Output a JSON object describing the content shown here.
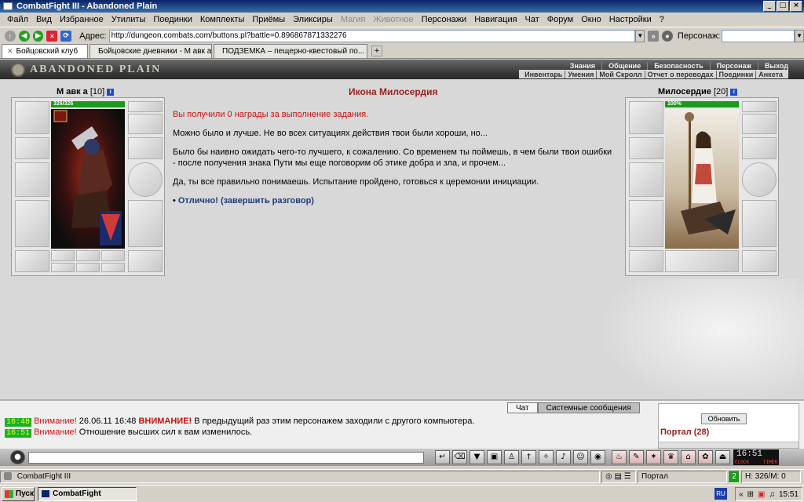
{
  "window": {
    "title": "CombatFight III - Abandoned Plain"
  },
  "menu": [
    "Файл",
    "Вид",
    "Избранное",
    "Утилиты",
    "Поединки",
    "Комплекты",
    "Приёмы",
    "Эликсиры",
    "Магия",
    "Животное",
    "Персонажи",
    "Навигация",
    "Чат",
    "Форум",
    "Окно",
    "Настройки",
    "?"
  ],
  "address": {
    "label": "Адрес:",
    "url": "http://dungeon.combats.com/buttons.pl?battle=0.896867871332276",
    "persona_label": "Персонаж:"
  },
  "tabs": [
    {
      "label": "Бойцовский клуб"
    },
    {
      "label": "Бойцовские дневники - М авк а"
    },
    {
      "label": "ПОДЗЕМКА – пещерно-квестовый по..."
    }
  ],
  "game": {
    "logo": "ABANDONED PLAIN",
    "top_nav": [
      "Знания",
      "Общение",
      "Безопасность",
      "Персонаж",
      "Выход"
    ],
    "sub_nav": [
      "Инвентарь",
      "Умения",
      "Мой Скролл",
      "Отчет о переводах",
      "Поединки",
      "Анкета"
    ],
    "player": {
      "name": "М авк а",
      "level": "[10]",
      "info": "i",
      "hp": "326/326"
    },
    "npc": {
      "name": "Милосердие",
      "level": "[20]",
      "info": "i",
      "hp": "100%"
    },
    "quest": {
      "title": "Икона Милосердия",
      "reward": "Вы получили 0 награды за выполнение задания.",
      "p1": "Можно было и лучше. Не во всех ситуациях действия твои были хороши, но...",
      "p2": "Было бы наивно ожидать чего-то лучшего, к сожалению. Со временем ты поймешь, в чем были твои ошибки - после получения знака Пути мы еще поговорим об этике добра и зла, и прочем...",
      "p3": "Да, ты все правильно понимаешь. Испытание пройдено, готовься к церемонии инициации.",
      "answer_bullet": "•",
      "answer": "Отлично! (завершить разговор)"
    }
  },
  "chat": {
    "tabs": [
      "Чат",
      "Системные сообщения"
    ],
    "lines": [
      {
        "time": "16:48",
        "prefix": "Внимание!",
        "date": "26.06.11 16:48",
        "bold": "ВНИМАНИЕ!",
        "text": "В предыдущий раз этим персонажем заходили с другого компьютера."
      },
      {
        "time": "16:51",
        "prefix": "Внимание!",
        "text": "Отношение высших сил к вам изменилось."
      }
    ],
    "refresh": "Обновить",
    "location": "Портал (28)"
  },
  "clock": {
    "time": "16:51",
    "label1": "CLOCK",
    "label2": "TIMER"
  },
  "statusbar": {
    "app": "CombatFight III",
    "location": "Портал",
    "counter": "2",
    "hp": "H: 326/М: 0"
  },
  "taskbar": {
    "start": "Пуск",
    "item": "CombatFight",
    "lang": "RU",
    "time": "15:51"
  },
  "colors": {
    "accent": "#9b1f1f",
    "hp_bar": "#1a9b1a",
    "title_bar": "#0a246a"
  }
}
